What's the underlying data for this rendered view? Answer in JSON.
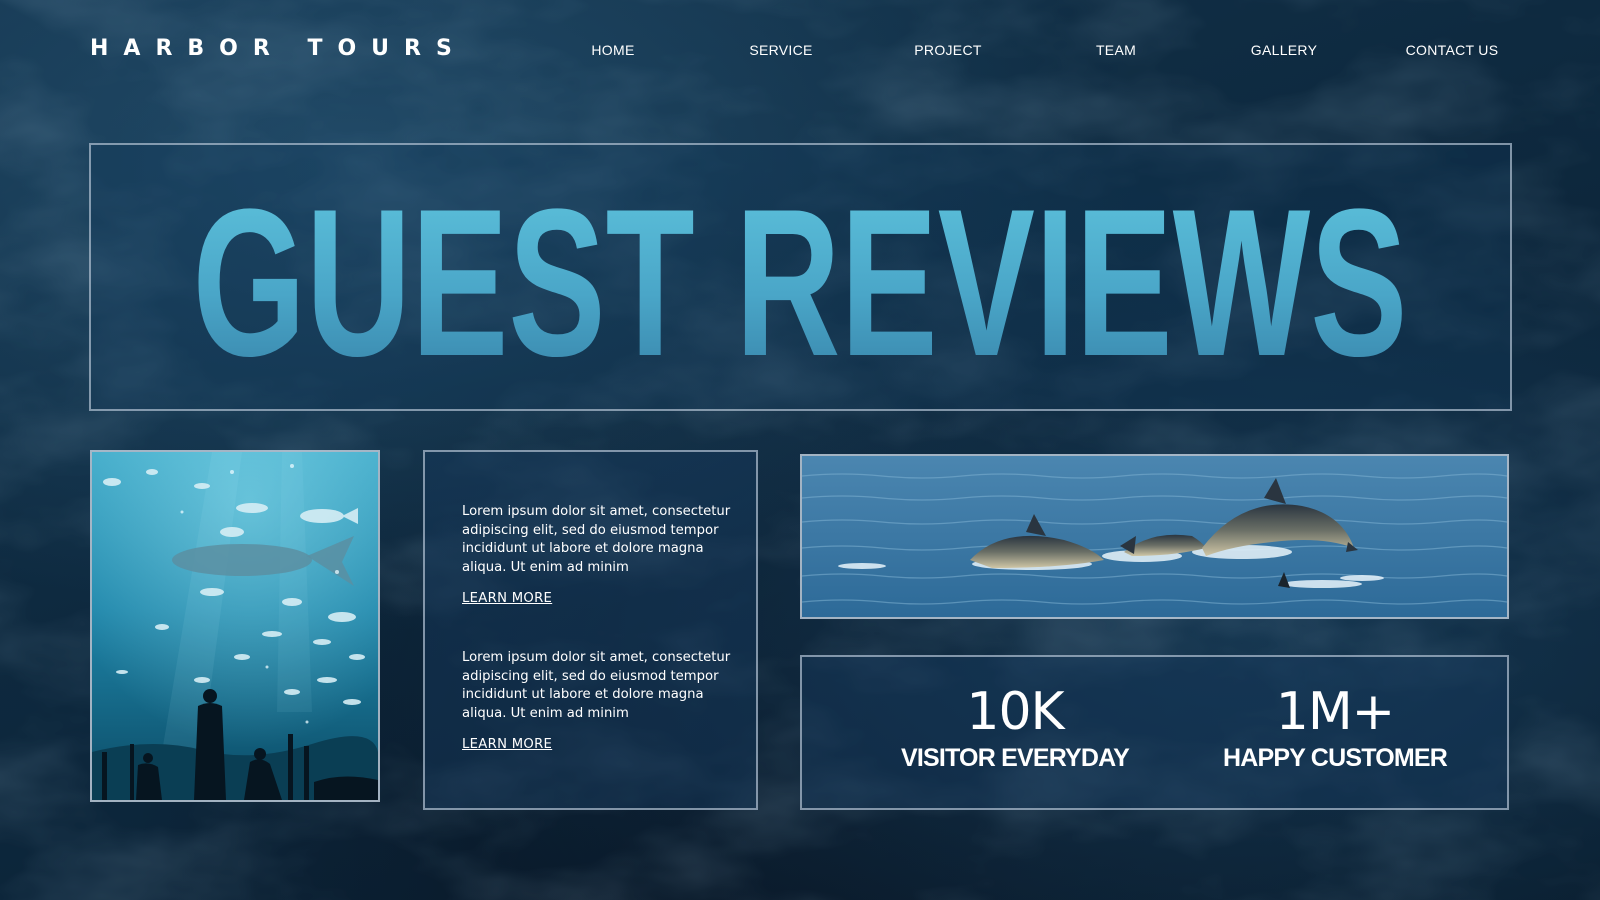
{
  "brand": {
    "name": "HARBOR TOURS"
  },
  "nav": {
    "items": [
      "HOME",
      "SERVICE",
      "PROJECT",
      "TEAM",
      "GALLERY",
      "CONTACT US"
    ]
  },
  "hero": {
    "title": "GUEST REVIEWS"
  },
  "reviews": [
    {
      "text": "Lorem ipsum dolor sit amet, consectetur adipiscing elit, sed do eiusmod tempor incididunt ut labore et dolore magna aliqua. Ut enim ad minim",
      "link": "LEARN MORE"
    },
    {
      "text": "Lorem ipsum dolor sit amet, consectetur adipiscing elit, sed do eiusmod tempor incididunt ut labore et dolore magna aliqua. Ut enim ad minim",
      "link": "LEARN MORE"
    }
  ],
  "stats": [
    {
      "value": "10K",
      "label": "VISITOR EVERYDAY"
    },
    {
      "value": "1M+",
      "label": "HAPPY CUSTOMER"
    }
  ],
  "colors": {
    "background": "#0e2a40",
    "title_top": "#5cc2dc",
    "title_bottom": "#3b88ac",
    "panel_border": "#bfcddc",
    "text": "#ffffff"
  },
  "images": {
    "aquarium": "aquarium-photo",
    "dolphins": "dolphins-photo"
  }
}
